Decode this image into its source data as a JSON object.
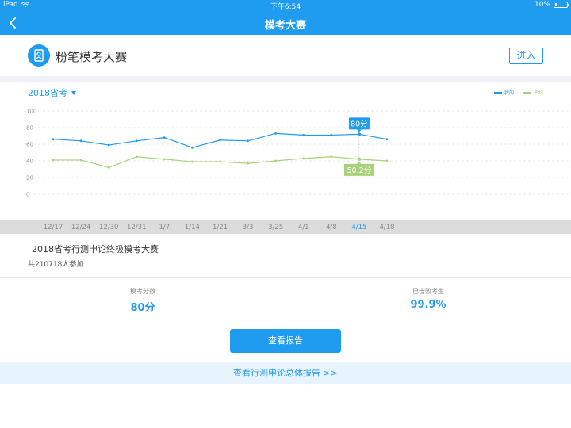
{
  "status_bar": {
    "device": "iPad",
    "time": "下午6:54",
    "battery": "10%",
    "battery_level": 0.1
  },
  "nav": {
    "title": "模考大赛"
  },
  "header": {
    "title": "粉笔模考大赛",
    "enter_label": "进入"
  },
  "chart": {
    "year_label": "2018省考",
    "callout_mine": "80分",
    "callout_avg": "50.2分"
  },
  "chart_data": {
    "type": "line",
    "categories": [
      "12/17",
      "12/24",
      "12/30",
      "12/31",
      "1/7",
      "1/14",
      "1/21",
      "3/3",
      "3/25",
      "4/1",
      "4/8",
      "4/15",
      "4/18"
    ],
    "series": [
      {
        "name": "我的",
        "color": "#1f9bf0",
        "values": [
          66,
          64,
          59,
          64,
          68,
          56,
          65,
          64,
          73,
          71,
          71,
          72,
          66
        ]
      },
      {
        "name": "平均",
        "color": "#a8d27a",
        "values": [
          41,
          41,
          32,
          45,
          42,
          39,
          39,
          37,
          40,
          43,
          45,
          42,
          40
        ]
      }
    ],
    "yticks": [
      100,
      80,
      60,
      40,
      20,
      0
    ],
    "ylim": [
      0,
      100
    ],
    "highlight_index": 11,
    "legend_position": "top-right",
    "grid": true
  },
  "exam": {
    "name": "2018省考行测申论终极模考大赛",
    "participants": "共210718人参加"
  },
  "stats": {
    "score_label": "模考分数",
    "score_value": "80分",
    "beat_label": "已击败考生",
    "beat_value": "99.9%"
  },
  "actions": {
    "view_report": "查看报告",
    "total_report": "查看行测申论总体报告 >>"
  },
  "colors": {
    "accent": "#1f9bf0",
    "avg": "#a8d27a"
  }
}
